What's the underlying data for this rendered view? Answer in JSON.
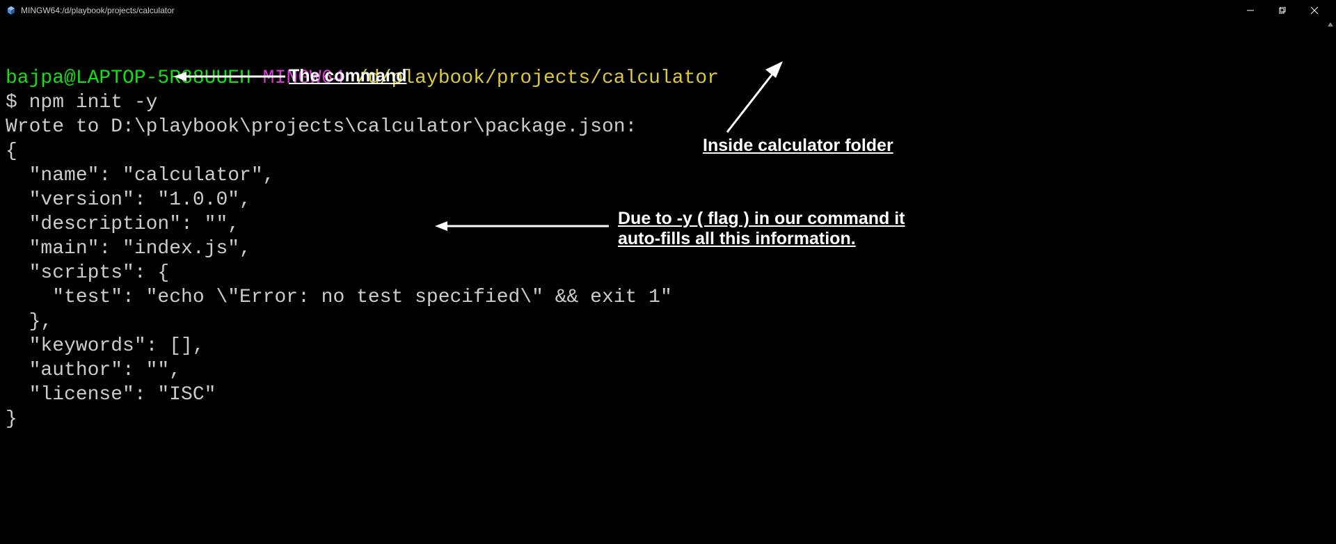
{
  "titlebar": {
    "title": "MINGW64:/d/playbook/projects/calculator"
  },
  "prompt": {
    "user": "bajpa@LAPTOP-5R38UUEH",
    "env": "MINGW64",
    "path": "/d/playbook/projects/calculator",
    "dollar": "$",
    "command": "npm init -y"
  },
  "output": {
    "wrote": "Wrote to D:\\playbook\\projects\\calculator\\package.json:",
    "blank1": "",
    "line_open": "{",
    "line_name": "  \"name\": \"calculator\",",
    "line_version": "  \"version\": \"1.0.0\",",
    "line_desc": "  \"description\": \"\",",
    "line_main": "  \"main\": \"index.js\",",
    "line_scripts": "  \"scripts\": {",
    "line_test": "    \"test\": \"echo \\\"Error: no test specified\\\" && exit 1\"",
    "line_scripts_close": "  },",
    "line_keywords": "  \"keywords\": [],",
    "line_author": "  \"author\": \"\",",
    "line_license": "  \"license\": \"ISC\"",
    "line_close": "}"
  },
  "annotations": {
    "cmd": "The command",
    "folder": "Inside calculator folder",
    "autofill": "Due to -y ( flag ) in our command it auto-fills all this information."
  }
}
